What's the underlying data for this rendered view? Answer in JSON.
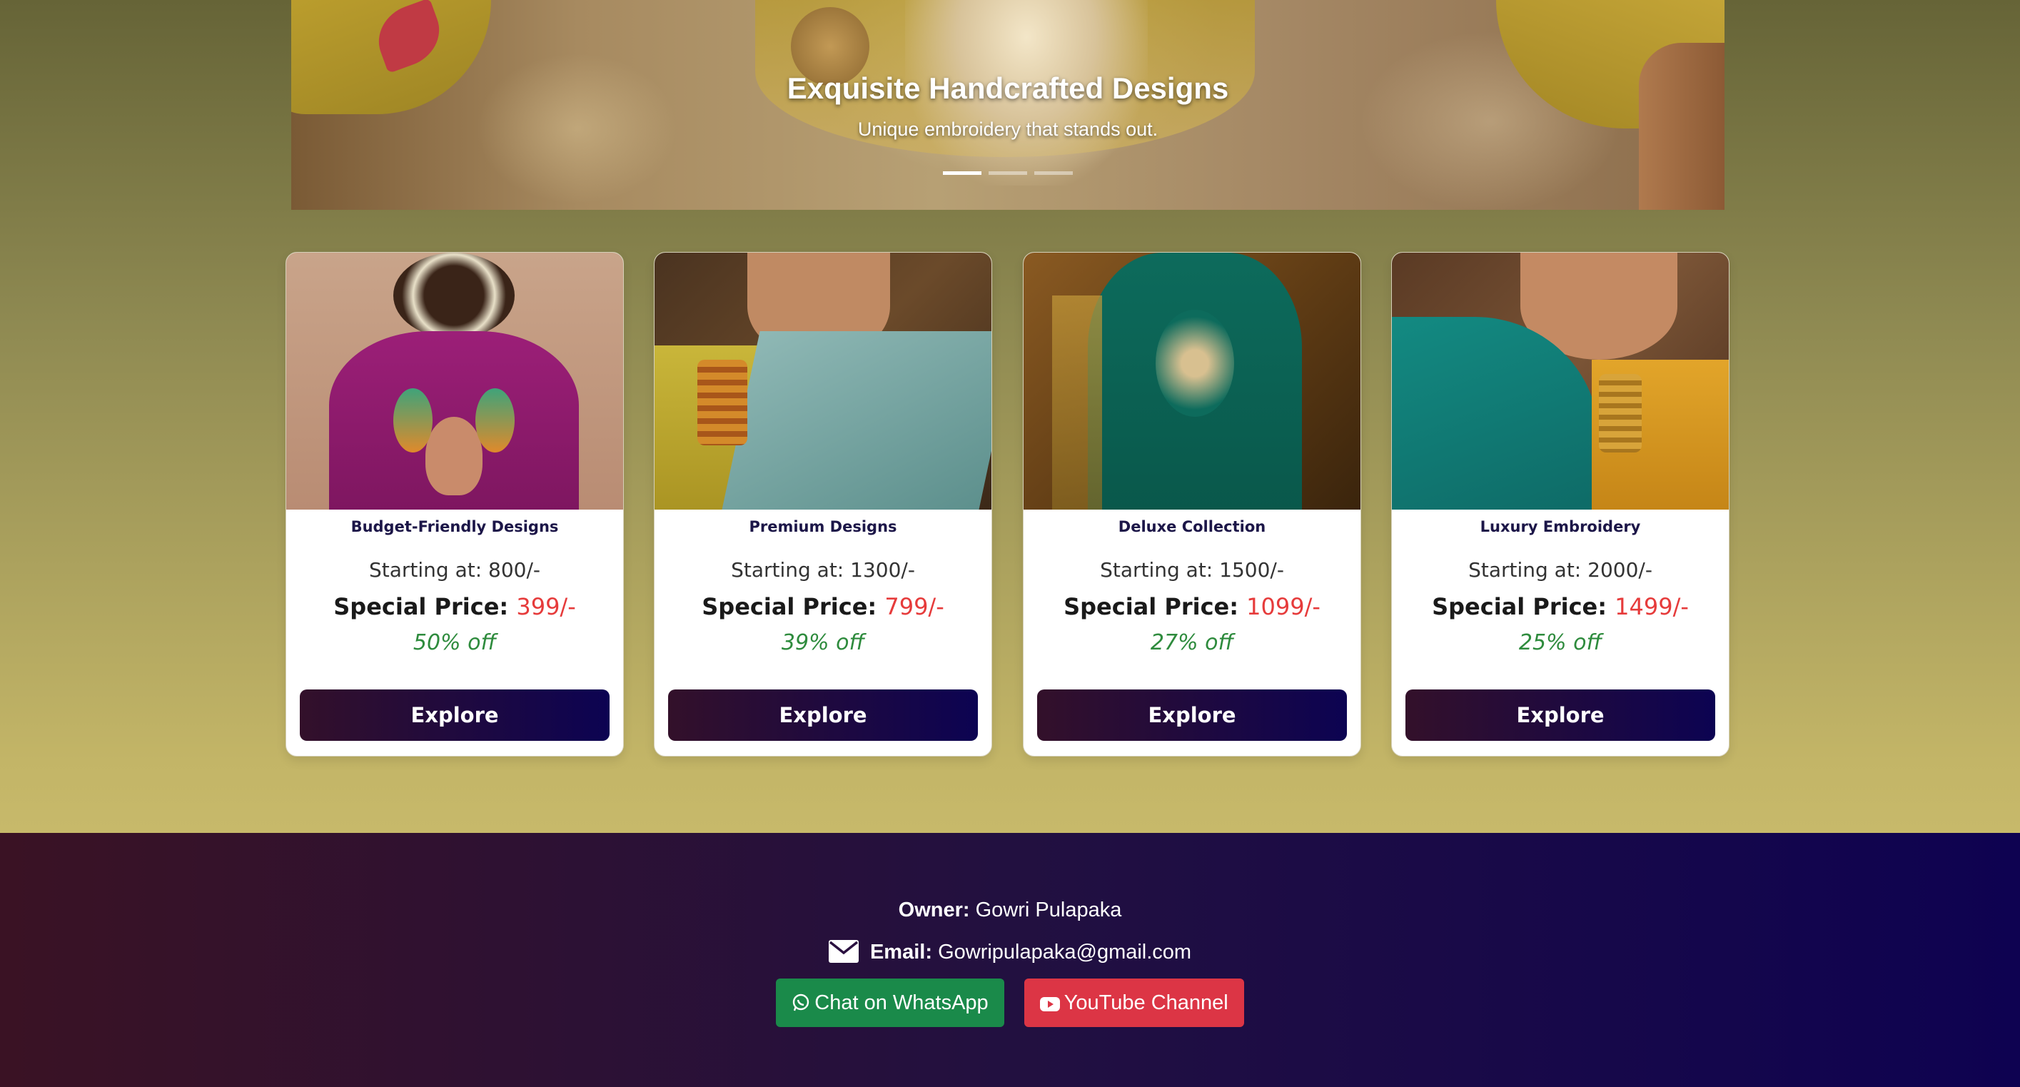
{
  "hero": {
    "title": "Exquisite Handcrafted Designs",
    "subtitle": "Unique embroidery that stands out.",
    "slide_count": 3,
    "active_slide": 1
  },
  "cards": [
    {
      "title": "Budget-Friendly Designs",
      "starting": "Starting at: 800/-",
      "special_label": "Special Price:",
      "special_price": "399/-",
      "discount": "50% off",
      "button": "Explore"
    },
    {
      "title": "Premium Designs",
      "starting": "Starting at: 1300/-",
      "special_label": "Special Price:",
      "special_price": "799/-",
      "discount": "39% off",
      "button": "Explore"
    },
    {
      "title": "Deluxe Collection",
      "starting": "Starting at: 1500/-",
      "special_label": "Special Price:",
      "special_price": "1099/-",
      "discount": "27% off",
      "button": "Explore"
    },
    {
      "title": "Luxury Embroidery",
      "starting": "Starting at: 2000/-",
      "special_label": "Special Price:",
      "special_price": "1499/-",
      "discount": "25% off",
      "button": "Explore"
    }
  ],
  "footer": {
    "owner_label": "Owner:",
    "owner_name": "Gowri Pulapaka",
    "email_label": "Email:",
    "email": "Gowripulapaka@gmail.com",
    "whatsapp_label": "Chat on WhatsApp",
    "youtube_label": "YouTube Channel"
  },
  "colors": {
    "price_red": "#e63b3b",
    "discount_green": "#2e8b3d",
    "button_dark": "#33102a",
    "button_navy": "#0c0352",
    "whatsapp_green": "#1a8a4a",
    "youtube_red": "#dc3545"
  }
}
